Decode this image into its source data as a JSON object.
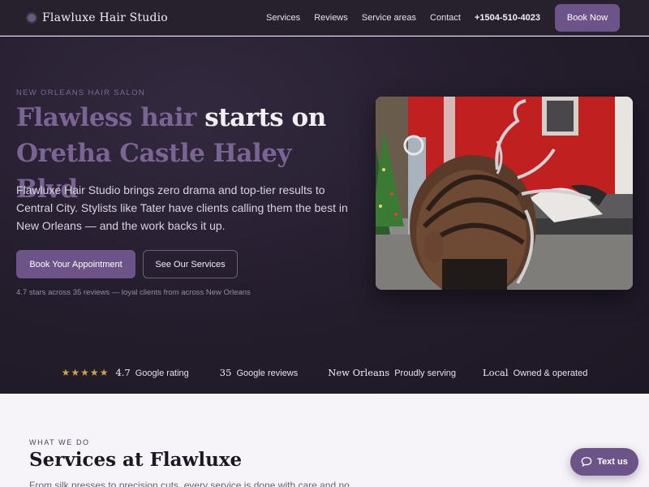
{
  "nav": {
    "brand": "Flawluxe Hair Studio",
    "links": [
      "Services",
      "Reviews",
      "Service areas",
      "Contact"
    ],
    "phone": "+1504-510-4023",
    "cta": "Book Now"
  },
  "hero": {
    "eyebrow": "NEW ORLEANS HAIR SALON",
    "headline_accent": "Flawless hair",
    "headline_rest": " starts on",
    "headline_line2": "Oretha Castle Haley Blvd",
    "copy": "Flawluxe Hair Studio brings zero drama and top-tier results to Central City. Stylists like Tater have clients calling them the best in New Orleans — and the work backs it up.",
    "primary_cta": "Book Your Appointment",
    "secondary_cta": "See Our Services",
    "note": "4.7 stars across 35 reviews — loyal clients from across New Orleans"
  },
  "stats": [
    {
      "strong": "4.7",
      "text": "Google rating",
      "stars": "★★★★★"
    },
    {
      "strong": "35",
      "text": "Google reviews"
    },
    {
      "strong": "New Orleans",
      "text": "Proudly serving"
    },
    {
      "strong": "Local",
      "text": "Owned & operated"
    }
  ],
  "services": {
    "eyebrow": "WHAT WE DO",
    "title": "Services at Flawluxe",
    "copy": "From silk presses to precision cuts, every service is done with care and no"
  },
  "chat": {
    "label": "Text us"
  },
  "icons": {
    "brand": "brand-dot-icon",
    "rating": "star-icon",
    "chat": "chat-bubble-icon"
  },
  "colors": {
    "accent": "#6c5488",
    "hero_bg": "#231c2b",
    "nav_bg": "#26212d",
    "star": "#c9a44c"
  }
}
